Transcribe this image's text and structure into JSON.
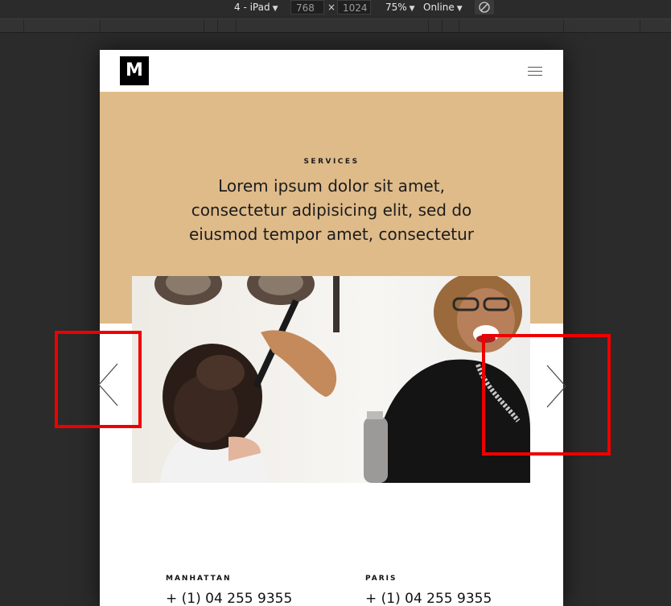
{
  "toolbar": {
    "device": "4 - iPad",
    "width": "768",
    "height": "1024",
    "times": "×",
    "zoom": "75%",
    "network": "Online",
    "caret": "▼"
  },
  "site": {
    "logo": "M",
    "hero_kicker": "SERVICES",
    "hero_text": "Lorem ipsum dolor sit amet, consectetur adipisicing elit, sed do eiusmod tempor amet, consectetur",
    "contacts": [
      {
        "city": "MANHATTAN",
        "phone": "+ (1) 04 255 9355"
      },
      {
        "city": "PARIS",
        "phone": "+ (1) 04 255 9355"
      }
    ]
  },
  "colors": {
    "hero_bg": "#dfbb8a",
    "highlight": "#ee0000",
    "chrome_bg": "#2b2b2b"
  },
  "icons": {
    "menu": "hamburger-icon",
    "rotate": "rotate-icon",
    "prev": "chevron-left-icon",
    "next": "chevron-right-icon"
  }
}
